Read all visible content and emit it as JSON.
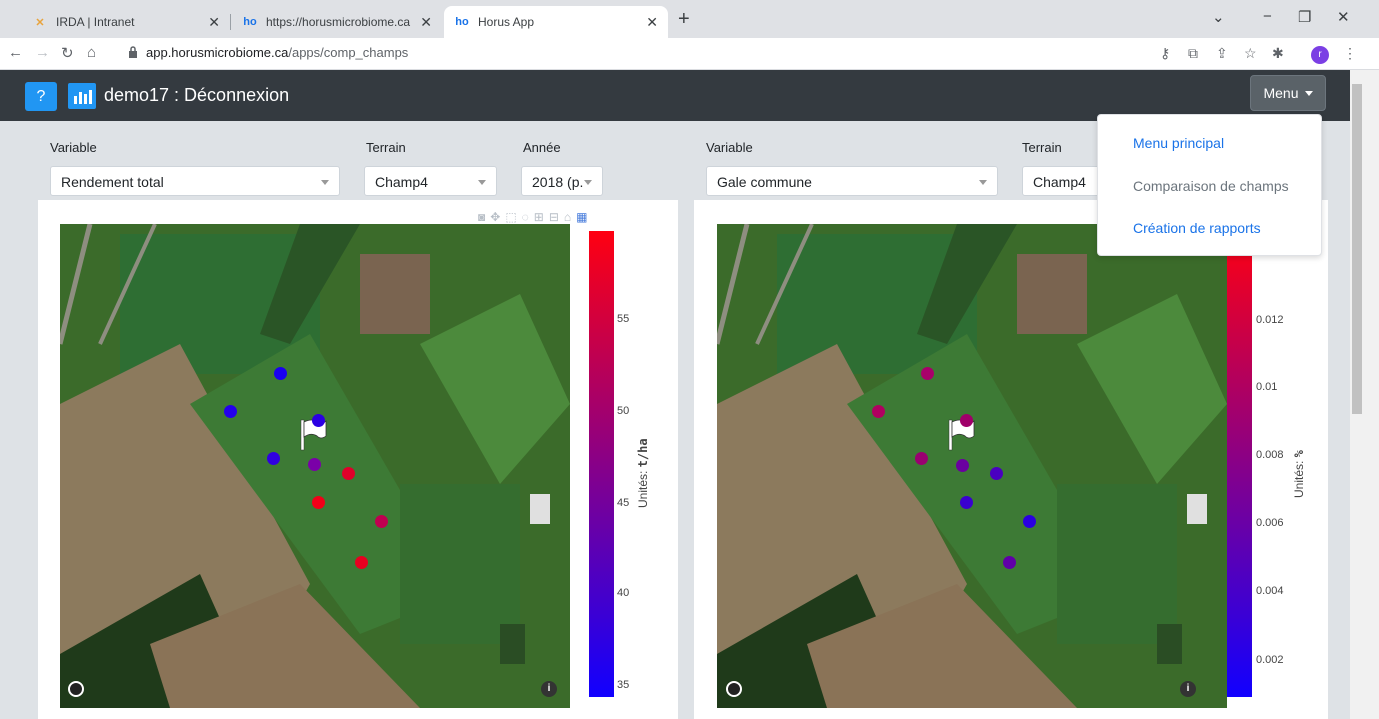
{
  "browser": {
    "tabs": [
      {
        "title": "IRDA | Intranet"
      },
      {
        "title": "https://horusmicrobiome.ca"
      },
      {
        "title": "Horus App"
      }
    ],
    "url_host": "app.horusmicrobiome.ca",
    "url_path": "/apps/comp_champs",
    "profile_initial": "r"
  },
  "app": {
    "help_label": "?",
    "title": "demo17 : Déconnexion",
    "menu_label": "Menu"
  },
  "dropdown": {
    "items": [
      "Menu principal",
      "Comparaison de champs",
      "Création de rapports"
    ],
    "active_color": "#1a73e8",
    "disabled_color": "#6c757d"
  },
  "left": {
    "variable_label": "Variable",
    "variable_value": "Rendement total",
    "terrain_label": "Terrain",
    "terrain_value": "Champ4",
    "annee_label": "Année",
    "annee_value": "2018 (p.",
    "units_prefix": "Unités: ",
    "units_value": "t/ha",
    "colorbar_ticks": [
      "55",
      "50",
      "45",
      "40",
      "35"
    ],
    "colorscale": [
      "#1100ff",
      "#ff0011"
    ]
  },
  "right": {
    "variable_label": "Variable",
    "variable_value": "Gale commune",
    "terrain_label": "Terrain",
    "terrain_value": "Champ4",
    "units_prefix": "Unités: ",
    "units_value": "%",
    "colorbar_ticks": [
      "0.012",
      "0.01",
      "0.008",
      "0.006",
      "0.004",
      "0.002"
    ],
    "colorscale": [
      "#1100ff",
      "#ff0011"
    ]
  }
}
